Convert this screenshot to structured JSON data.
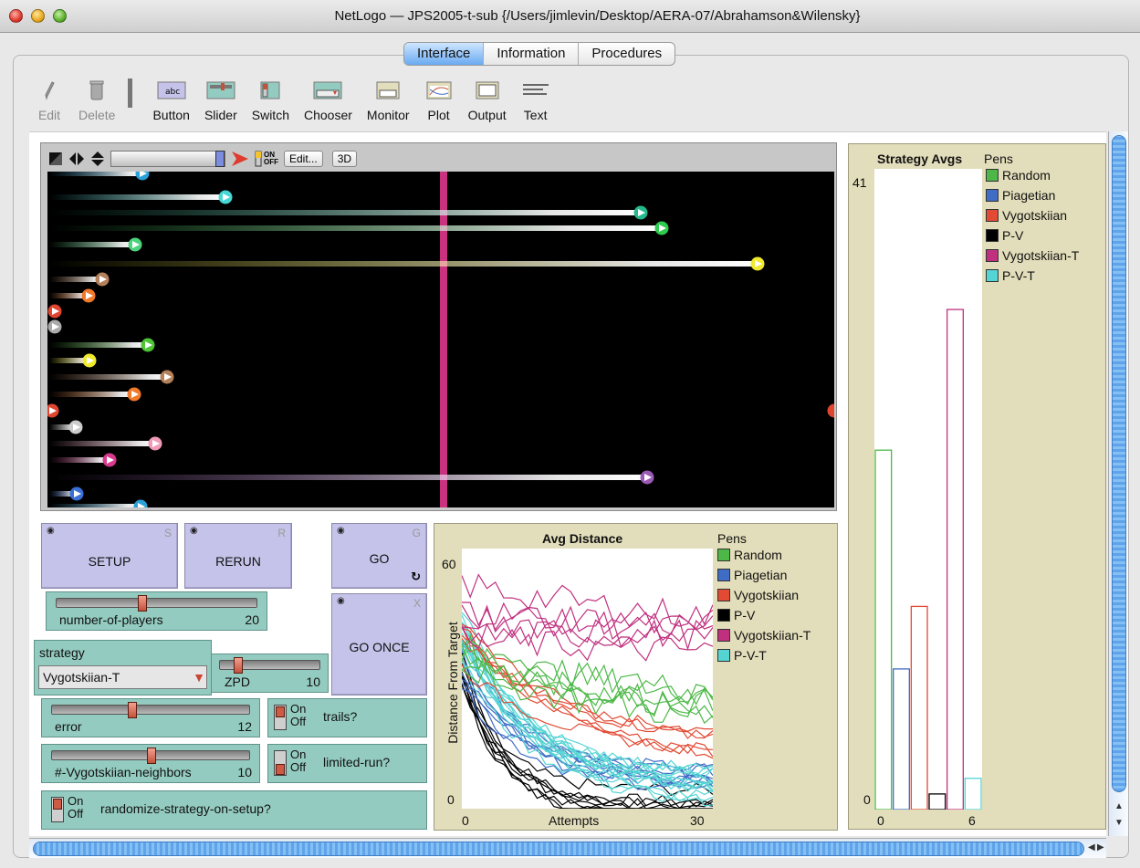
{
  "window": {
    "title": "NetLogo — JPS2005-t-sub {/Users/jimlevin/Desktop/AERA-07/Abrahamson&Wilensky}"
  },
  "tabs": [
    {
      "label": "Interface",
      "active": true
    },
    {
      "label": "Information",
      "active": false
    },
    {
      "label": "Procedures",
      "active": false
    }
  ],
  "toolbar": {
    "edit": "Edit",
    "delete": "Delete",
    "button": "Button",
    "slider": "Slider",
    "switch": "Switch",
    "chooser": "Chooser",
    "monitor": "Monitor",
    "plot": "Plot",
    "output": "Output",
    "text": "Text"
  },
  "view": {
    "edit_label": "Edit...",
    "three_d_label": "3D",
    "on_label": "ON",
    "off_label": "OFF",
    "target_color": "#c8327e"
  },
  "turtles": [
    {
      "y": 2,
      "x": 156,
      "color": "#2ba0d8"
    },
    {
      "y": 28,
      "x": 247,
      "color": "#45d6d6"
    },
    {
      "y": 45,
      "x": 702,
      "color": "#23b98c"
    },
    {
      "y": 62,
      "x": 725,
      "color": "#2ecc4e"
    },
    {
      "y": 80,
      "x": 148,
      "color": "#4cd37d"
    },
    {
      "y": 101,
      "x": 830,
      "color": "#f0ea2a"
    },
    {
      "y": 118,
      "x": 112,
      "color": "#b4805a"
    },
    {
      "y": 136,
      "x": 97,
      "color": "#f07a2a"
    },
    {
      "y": 153,
      "x": 60,
      "color": "#e04530"
    },
    {
      "y": 170,
      "x": 60,
      "color": "#aaaaaa"
    },
    {
      "y": 190,
      "x": 162,
      "color": "#4ec437"
    },
    {
      "y": 207,
      "x": 98,
      "color": "#f0ea2a"
    },
    {
      "y": 225,
      "x": 183,
      "color": "#b4805a"
    },
    {
      "y": 244,
      "x": 147,
      "color": "#f07a2a"
    },
    {
      "y": 262,
      "x": 57,
      "color": "#e04530"
    },
    {
      "y": 280,
      "x": 83,
      "color": "#cccccc"
    },
    {
      "y": 298,
      "x": 170,
      "color": "#f09ab8"
    },
    {
      "y": 316,
      "x": 120,
      "color": "#d93a8c"
    },
    {
      "y": 335,
      "x": 709,
      "color": "#9b59b6"
    },
    {
      "y": 353,
      "x": 84,
      "color": "#3a6fd6"
    },
    {
      "y": 367,
      "x": 154,
      "color": "#2ba0d8"
    }
  ],
  "buttons": {
    "setup": {
      "label": "SETUP",
      "key": "S"
    },
    "rerun": {
      "label": "RERUN",
      "key": "R"
    },
    "go": {
      "label": "GO",
      "key": "G",
      "forever_icon": "loop-icon"
    },
    "go_once": {
      "label": "GO ONCE",
      "key": "X"
    }
  },
  "sliders": {
    "players": {
      "name": "number-of-players",
      "value": "20",
      "fraction": 0.42
    },
    "zpd": {
      "name": "ZPD",
      "value": "10",
      "fraction": 0.15
    },
    "error": {
      "name": "error",
      "value": "12",
      "fraction": 0.4
    },
    "neighbors": {
      "name": "#-Vygotskiian-neighbors",
      "value": "10",
      "fraction": 0.5
    }
  },
  "switches": {
    "trails": {
      "name": "trails?",
      "on": "On",
      "off": "Off"
    },
    "limited": {
      "name": "limited-run?",
      "on": "On",
      "off": "Off"
    },
    "randomize": {
      "name": "randomize-strategy-on-setup?",
      "on": "On",
      "off": "Off"
    }
  },
  "chooser": {
    "name": "strategy",
    "value": "Vygotskiian-T"
  },
  "pens": [
    {
      "name": "Random",
      "color": "#4db848"
    },
    {
      "name": "Piagetian",
      "color": "#3f6cc4"
    },
    {
      "name": "Vygotskiian",
      "color": "#e24a33"
    },
    {
      "name": "P-V",
      "color": "#000000"
    },
    {
      "name": "Vygotskiian-T",
      "color": "#c0307f"
    },
    {
      "name": "P-V-T",
      "color": "#55d4d4"
    }
  ],
  "pens_title": "Pens",
  "avg_plot": {
    "title": "Avg Distance",
    "ylabel": "Distance From Target",
    "xlabel": "Attempts",
    "ymax": "60",
    "ymin": "0",
    "xmin": "0",
    "xmax": "30"
  },
  "strategy_plot": {
    "title": "Strategy Avgs",
    "ymax": "41",
    "ymin": "0",
    "xmin": "0",
    "xmax": "6"
  },
  "chart_data": {
    "type": "bar",
    "title": "Strategy Avgs",
    "categories": [
      "Random",
      "Piagetian",
      "Vygotskiian",
      "P-V",
      "Vygotskiian-T",
      "P-V-T"
    ],
    "values": [
      23,
      9,
      13,
      1,
      32,
      2
    ],
    "ylim": [
      0,
      41
    ],
    "xlim": [
      0,
      6
    ]
  }
}
